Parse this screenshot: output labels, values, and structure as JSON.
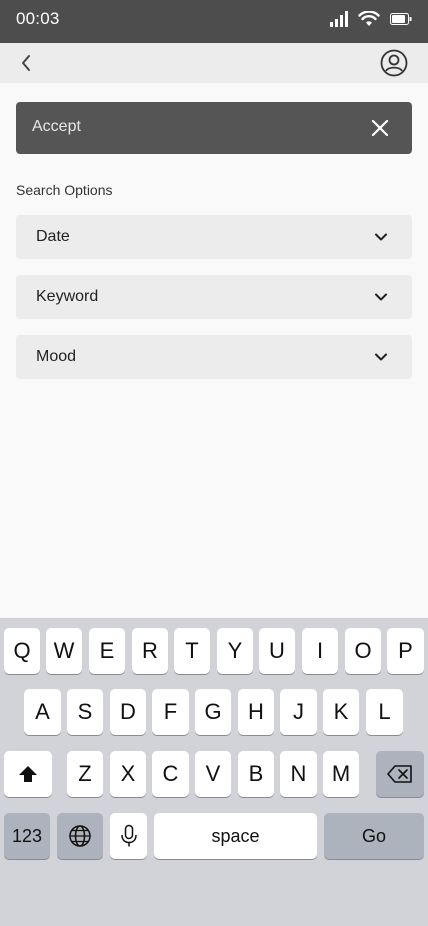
{
  "status": {
    "time": "00:03"
  },
  "search": {
    "value": "Accept"
  },
  "section": {
    "title": "Search Options"
  },
  "options": [
    {
      "label": "Date"
    },
    {
      "label": "Keyword"
    },
    {
      "label": "Mood"
    }
  ],
  "keyboard": {
    "row1": [
      "Q",
      "W",
      "E",
      "R",
      "T",
      "Y",
      "U",
      "I",
      "O",
      "P"
    ],
    "row2": [
      "A",
      "S",
      "D",
      "F",
      "G",
      "H",
      "J",
      "K",
      "L"
    ],
    "row3": [
      "Z",
      "X",
      "C",
      "V",
      "B",
      "N",
      "M"
    ],
    "numbers_label": "123",
    "space_label": "space",
    "go_label": "Go"
  }
}
